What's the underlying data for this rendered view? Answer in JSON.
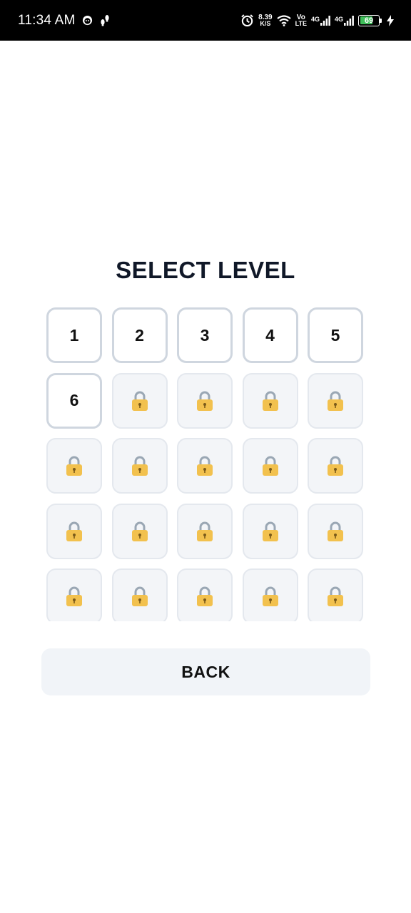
{
  "status_bar": {
    "time": "11:34 AM",
    "net_speed_value": "8.39",
    "net_speed_unit": "K/S",
    "volte_top": "Vo",
    "volte_bottom": "LTE",
    "sim1_type": "4G",
    "sim2_type": "4G",
    "battery_percent": "69",
    "battery_level": 0.69,
    "battery_color": "#3fbf5a",
    "icons": [
      "face-icon",
      "footprint-icon",
      "alarm-icon",
      "wifi-icon",
      "signal-icon",
      "charging-icon"
    ]
  },
  "title": "SELECT LEVEL",
  "levels": [
    {
      "label": "1",
      "locked": false
    },
    {
      "label": "2",
      "locked": false
    },
    {
      "label": "3",
      "locked": false
    },
    {
      "label": "4",
      "locked": false
    },
    {
      "label": "5",
      "locked": false
    },
    {
      "label": "6",
      "locked": false
    },
    {
      "label": "",
      "locked": true
    },
    {
      "label": "",
      "locked": true
    },
    {
      "label": "",
      "locked": true
    },
    {
      "label": "",
      "locked": true
    },
    {
      "label": "",
      "locked": true
    },
    {
      "label": "",
      "locked": true
    },
    {
      "label": "",
      "locked": true
    },
    {
      "label": "",
      "locked": true
    },
    {
      "label": "",
      "locked": true
    },
    {
      "label": "",
      "locked": true
    },
    {
      "label": "",
      "locked": true
    },
    {
      "label": "",
      "locked": true
    },
    {
      "label": "",
      "locked": true
    },
    {
      "label": "",
      "locked": true
    },
    {
      "label": "",
      "locked": true
    },
    {
      "label": "",
      "locked": true
    },
    {
      "label": "",
      "locked": true
    },
    {
      "label": "",
      "locked": true
    },
    {
      "label": "",
      "locked": true
    }
  ],
  "back_button": {
    "label": "BACK"
  },
  "colors": {
    "title": "#101828",
    "unlocked_border": "#cfd6df",
    "locked_bg": "#f3f5f8",
    "lock_body": "#f2c14e",
    "lock_shackle": "#9aa7b4"
  }
}
